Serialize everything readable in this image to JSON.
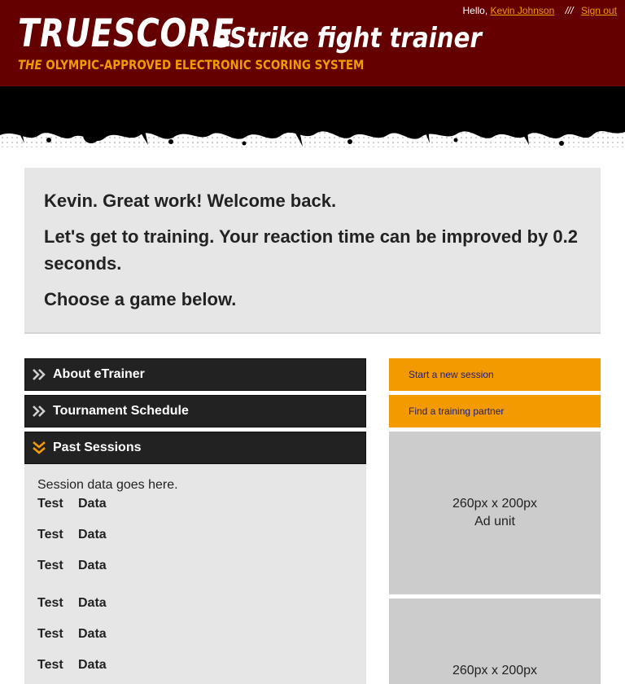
{
  "header": {
    "brand": "Truescore",
    "product": "eStrike fight trainer",
    "tagline_prefix": "The",
    "tagline_rest": "Olympic-approved electronic scoring system",
    "user": {
      "hello": "Hello,",
      "name": "Kevin Johnson",
      "separator": "///",
      "signout": "Sign out"
    },
    "colors": {
      "header_bg": "#640000",
      "accent": "#f29a00"
    }
  },
  "welcome": {
    "line1": "Kevin. Great work! Welcome back.",
    "line2": "Let's get to training. Your reaction time can be improved by 0.2 seconds.",
    "line3": "Choose a game below."
  },
  "accordion": {
    "items": [
      {
        "label": "About eTrainer",
        "icon": "double-chevron-right-icon",
        "expanded": false
      },
      {
        "label": "Tournament Schedule",
        "icon": "double-chevron-right-icon",
        "expanded": false
      },
      {
        "label": "Past Sessions",
        "icon": "double-chevron-down-icon",
        "expanded": true
      }
    ]
  },
  "sessions": {
    "intro": "Session data goes here.",
    "rows": [
      {
        "c1": "Test",
        "c2": "Data"
      },
      {
        "c1": "Test",
        "c2": "Data"
      },
      {
        "c1": "Test",
        "c2": "Data"
      },
      {
        "c1": "Test",
        "c2": "Data"
      },
      {
        "c1": "Test",
        "c2": "Data"
      },
      {
        "c1": "Test",
        "c2": "Data"
      }
    ]
  },
  "sidebar": {
    "actions": [
      "Start a new session",
      "Find a training partner"
    ],
    "ads": [
      {
        "size": "260px x 200px",
        "label": "Ad unit"
      },
      {
        "size": "260px x 200px",
        "label": ""
      }
    ]
  }
}
